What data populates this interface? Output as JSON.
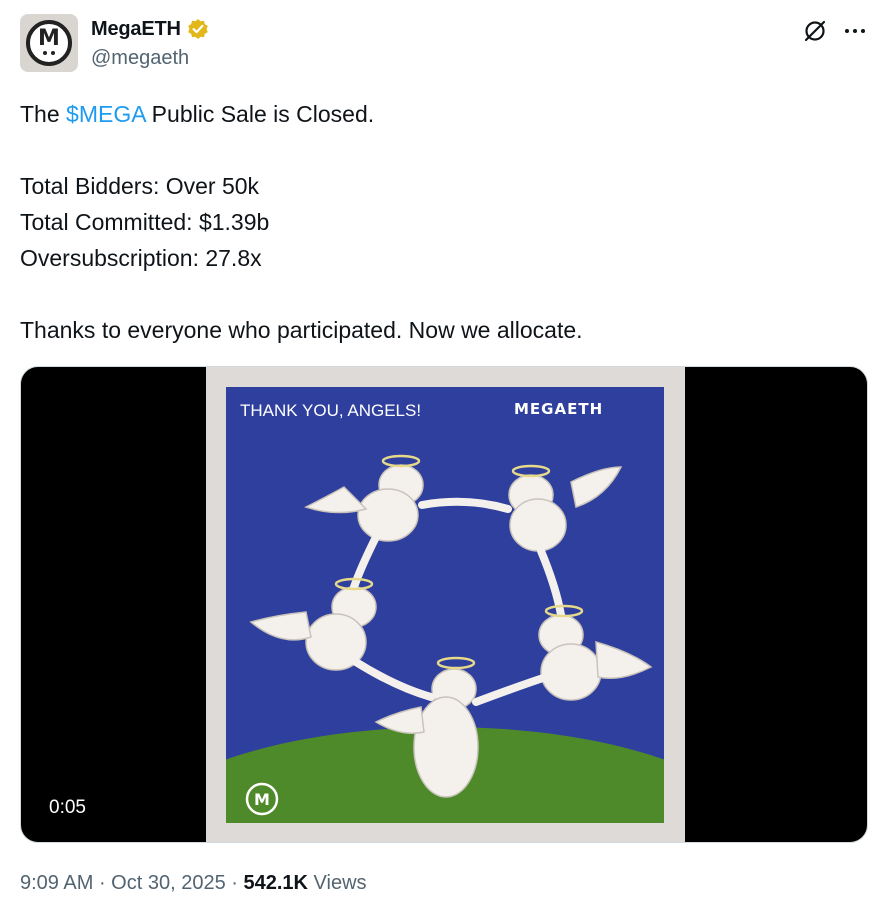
{
  "account": {
    "display_name": "MegaETH",
    "handle": "@megaeth",
    "avatar_letter": "M",
    "verified_badge": "gold-verified-badge-icon"
  },
  "tweet": {
    "prefix": "The ",
    "cashtag": "$MEGA",
    "suffix": " Public Sale is Closed.",
    "stats": [
      "Total Bidders: Over 50k",
      "Total Committed: $1.39b",
      "Oversubscription: 27.8x"
    ],
    "closing": "Thanks to everyone who participated. Now we allocate."
  },
  "media": {
    "type": "video",
    "duration": "0:05",
    "poster_title": "THANK YOU, ANGELS!",
    "poster_brand": "MEGAETH",
    "poster_logo_letter": "M"
  },
  "meta": {
    "time": "9:09 AM",
    "separator": " · ",
    "date": "Oct 30, 2025",
    "views_count": "542.1K",
    "views_label": " Views"
  },
  "colors": {
    "accent": "#1d9bf0",
    "text": "#0f1419",
    "muted": "#536471",
    "verified_gold": "#e2b719",
    "poster_sky": "#2f3f9e",
    "poster_ground": "#4f8a2a"
  }
}
